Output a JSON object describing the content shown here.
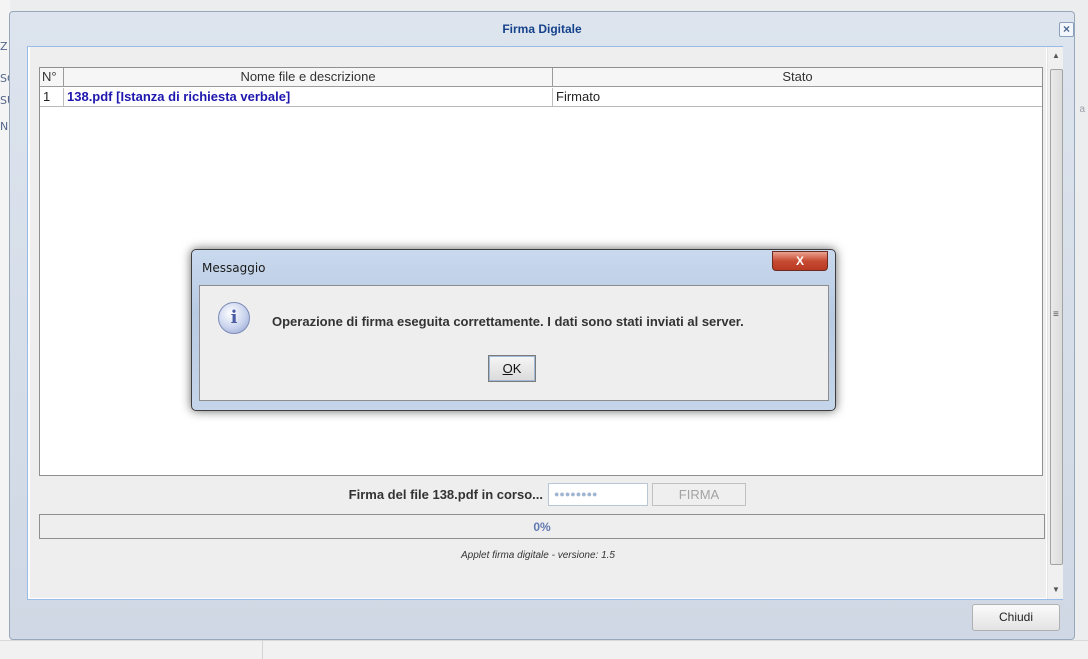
{
  "window": {
    "title": "Firma Digitale",
    "close_glyph": "×"
  },
  "table": {
    "columns": [
      "N°",
      "Nome file e descrizione",
      "Stato"
    ],
    "rows": [
      {
        "n": "1",
        "file": "138.pdf [Istanza di richiesta verbale]",
        "stato": "Firmato"
      }
    ]
  },
  "status": {
    "label": "Firma del file 138.pdf in corso...",
    "password_mask": "●●●●●●●●",
    "sign_button": "FIRMA"
  },
  "progress": {
    "text": "0%",
    "value": 0
  },
  "version_text": "Applet firma digitale - versione: 1.5",
  "footer": {
    "close_button": "Chiudi"
  },
  "dialog": {
    "title": "Messaggio",
    "close_glyph": "X",
    "message": "Operazione di firma eseguita correttamente. I dati sono stati inviati al server.",
    "ok_underlined": "O",
    "ok_rest": "K",
    "icon": "info-icon"
  },
  "scrollbar": {
    "up_glyph": "▲",
    "down_glyph": "▼",
    "grip_glyph": "≡"
  },
  "background": {
    "letters": [
      "Z",
      "SC",
      "SU",
      "N"
    ],
    "right_letter": "a"
  }
}
